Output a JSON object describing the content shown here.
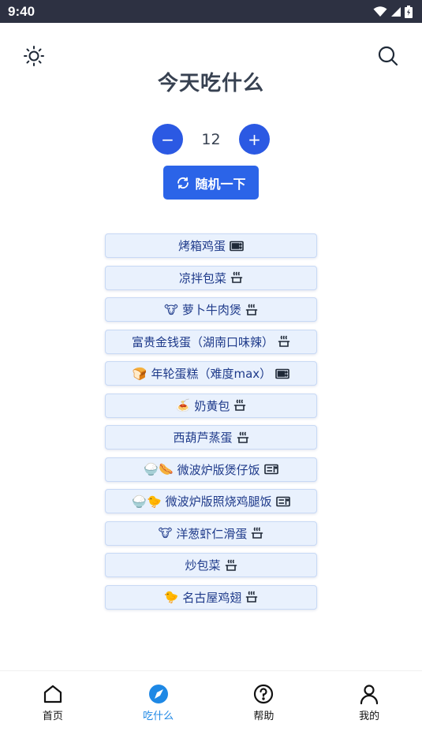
{
  "status": {
    "time": "9:40"
  },
  "header": {
    "title": "今天吃什么"
  },
  "stepper": {
    "decrement_label": "−",
    "value": "12",
    "increment_label": "+"
  },
  "random_button": {
    "label": "随机一下"
  },
  "dishes": [
    {
      "prefix": "",
      "name": "烤箱鸡蛋",
      "tool": "oven"
    },
    {
      "prefix": "",
      "name": "凉拌包菜",
      "tool": "pot"
    },
    {
      "prefix": "🐮",
      "name": "萝卜牛肉煲",
      "tool": "pot"
    },
    {
      "prefix": "",
      "name": "富贵金钱蛋（湖南口味辣）",
      "tool": "pot"
    },
    {
      "prefix": "🍞",
      "name": "年轮蛋糕（难度max）",
      "tool": "oven"
    },
    {
      "prefix": "🍝",
      "name": "奶黄包",
      "tool": "pot"
    },
    {
      "prefix": "",
      "name": "西葫芦蒸蛋",
      "tool": "pot"
    },
    {
      "prefix": "🍚🌭",
      "name": "微波炉版煲仔饭",
      "tool": "microwave"
    },
    {
      "prefix": "🍚🐤",
      "name": "微波炉版照烧鸡腿饭",
      "tool": "microwave"
    },
    {
      "prefix": "🐮",
      "name": "洋葱虾仁滑蛋",
      "tool": "pot"
    },
    {
      "prefix": "",
      "name": "炒包菜",
      "tool": "pot"
    },
    {
      "prefix": "🐤",
      "name": "名古屋鸡翅",
      "tool": "pot"
    }
  ],
  "bottom_nav": [
    {
      "label": "首页",
      "icon": "home-icon",
      "active": false
    },
    {
      "label": "吃什么",
      "icon": "compass-icon",
      "active": true
    },
    {
      "label": "帮助",
      "icon": "help-icon",
      "active": false
    },
    {
      "label": "我的",
      "icon": "user-icon",
      "active": false
    }
  ],
  "colors": {
    "primary": "#2b59e3",
    "nav_active": "#1e88e5",
    "dish_bg": "#e9f1fd",
    "dish_text": "#1e3a8a"
  }
}
